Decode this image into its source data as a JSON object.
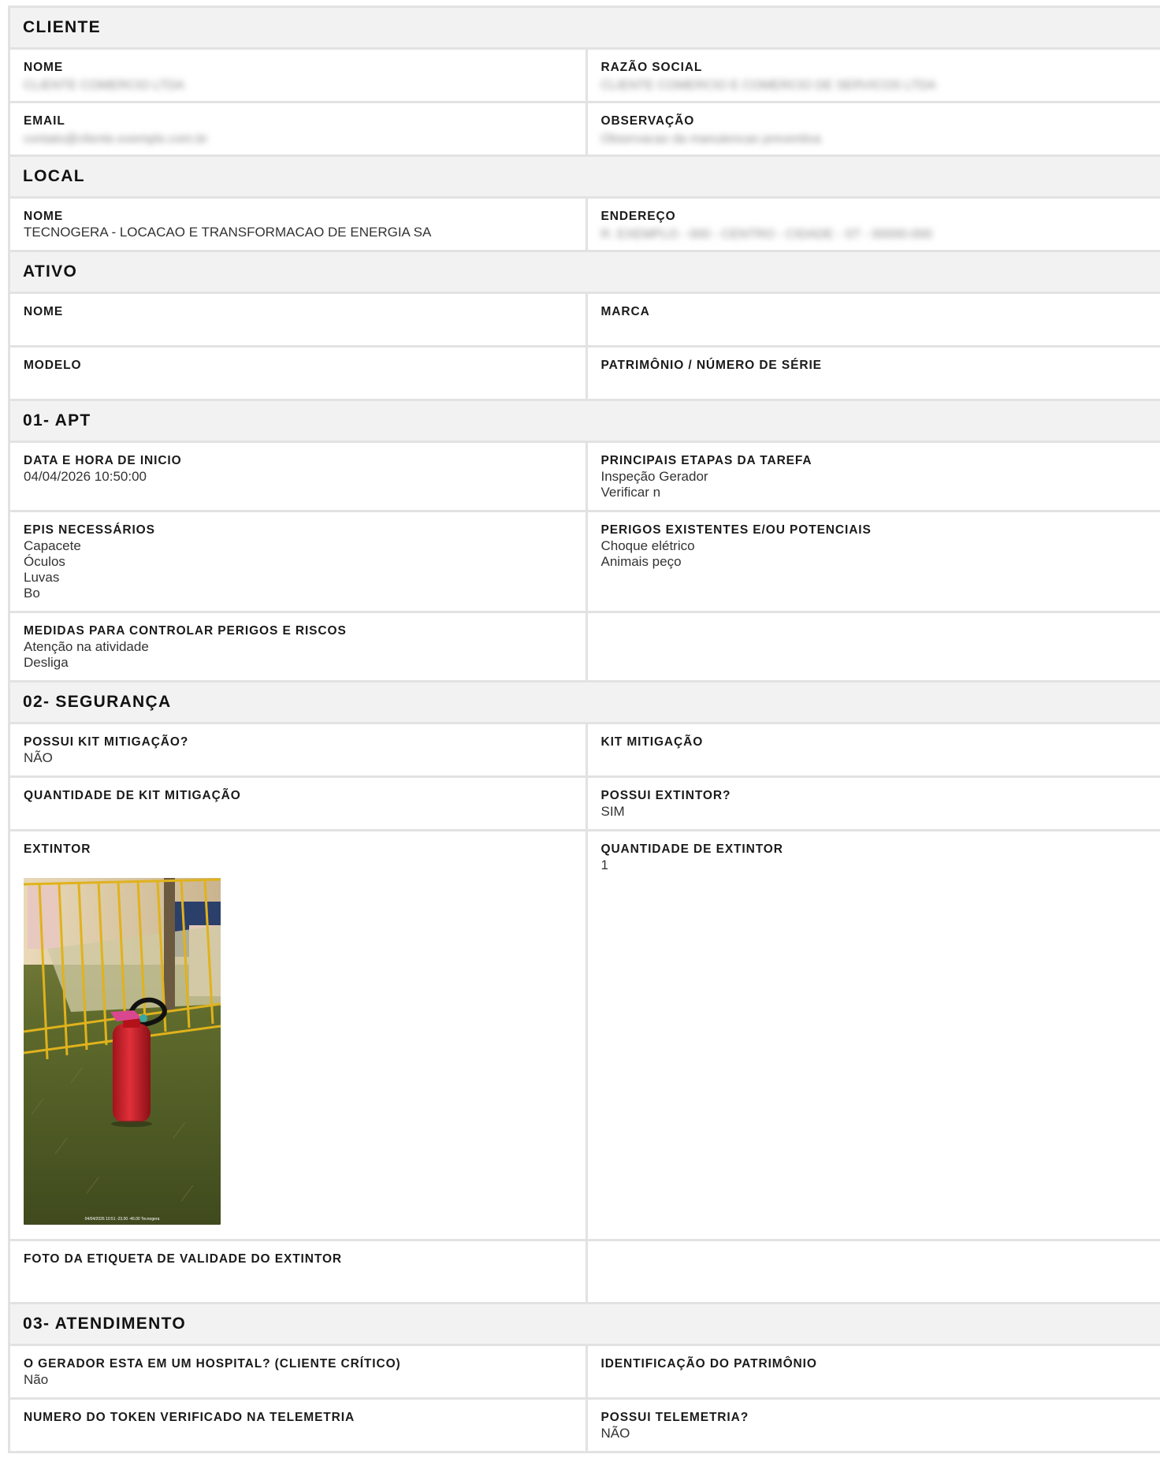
{
  "cliente": {
    "title": "CLIENTE",
    "nome_label": "NOME",
    "nome_value": "CLIENTE COMERCIO LTDA",
    "razao_label": "RAZÃO SOCIAL",
    "razao_value": "CLIENTE COMERCIO E COMERCIO DE SERVICOS LTDA",
    "email_label": "EMAIL",
    "email_value": "contato@cliente.exemplo.com.br",
    "obs_label": "OBSERVAÇÃO",
    "obs_value": "Observacao da manutencao preventiva"
  },
  "local": {
    "title": "LOCAL",
    "nome_label": "NOME",
    "nome_value": "TECNOGERA - LOCACAO E TRANSFORMACAO DE ENERGIA SA",
    "endereco_label": "ENDEREÇO",
    "endereco_value": "R. EXEMPLO - 000 - CENTRO - CIDADE - ST - 00000-000"
  },
  "ativo": {
    "title": "ATIVO",
    "nome_label": "NOME",
    "nome_value": "",
    "marca_label": "MARCA",
    "marca_value": "",
    "modelo_label": "MODELO",
    "modelo_value": "",
    "patrimonio_label": "PATRIMÔNIO / NÚMERO DE SÉRIE",
    "patrimonio_value": ""
  },
  "apt": {
    "title": "01- APT",
    "data_label": "DATA E HORA DE INICIO",
    "data_value": "04/04/2026 10:50:00",
    "etapas_label": "PRINCIPAIS ETAPAS DA TAREFA",
    "etapas_value": "Inspeção Gerador\nVerificar n",
    "epis_label": "EPIS NECESSÁRIOS",
    "epis_value": "Capacete\nÓculos\nLuvas\nBo",
    "perigos_label": "PERIGOS EXISTENTES E/OU POTENCIAIS",
    "perigos_value": "Choque elétrico\nAnimais peço",
    "medidas_label": "MEDIDAS PARA CONTROLAR PERIGOS E RISCOS",
    "medidas_value": "Atenção na atividade\nDesliga"
  },
  "seguranca": {
    "title": "02- SEGURANÇA",
    "kit_q_label": "POSSUI KIT MITIGAÇÃO?",
    "kit_q_value": "NÃO",
    "kit_label": "KIT MITIGAÇÃO",
    "kit_value": "",
    "qtd_kit_label": "QUANTIDADE DE KIT MITIGAÇÃO",
    "qtd_kit_value": "",
    "ext_q_label": "POSSUI EXTINTOR?",
    "ext_q_value": "SIM",
    "ext_label": "EXTINTOR",
    "ext_photo_caption": "04/04/2026 10:51 -23.00 -46.00 Tecnogera",
    "qtd_ext_label": "QUANTIDADE DE EXTINTOR",
    "qtd_ext_value": "1",
    "foto_label": "FOTO DA ETIQUETA DE VALIDADE DO EXTINTOR"
  },
  "atendimento": {
    "title": "03- ATENDIMENTO",
    "hospital_label": "O GERADOR ESTA EM UM HOSPITAL? (CLIENTE CRÍTICO)",
    "hospital_value": "Não",
    "ident_label": "IDENTIFICAÇÃO DO PATRIMÔNIO",
    "ident_value": "",
    "token_label": "NUMERO DO TOKEN VERIFICADO NA TELEMETRIA",
    "token_value": "",
    "telemetria_label": "POSSUI TELEMETRIA?",
    "telemetria_value": "NÃO"
  }
}
